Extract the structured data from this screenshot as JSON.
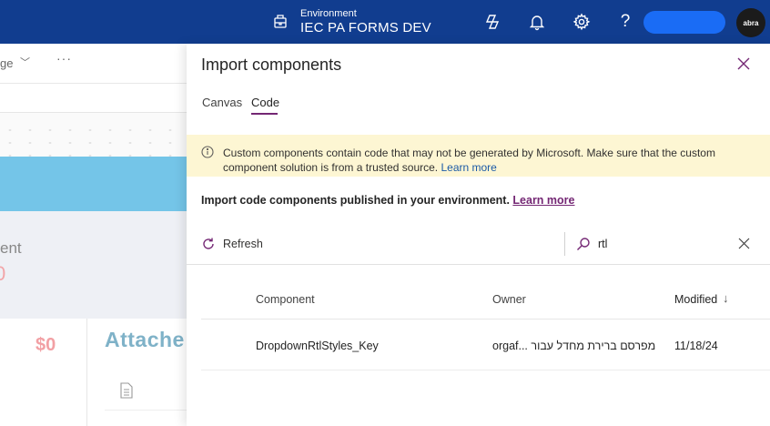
{
  "topbar": {
    "env_label": "Environment",
    "env_name": "IEC PA FORMS DEV",
    "icons": [
      "copilot-icon",
      "bell-icon",
      "gear-icon",
      "help-icon"
    ],
    "help_glyph": "?",
    "avatar_text": "abra",
    "colors": {
      "background": "#113d8f",
      "user_pill": "#1a6cf5"
    }
  },
  "background_app": {
    "page_label": "ge",
    "more": "···",
    "partial_label": "ent",
    "value_1": "0",
    "value_2": "$0",
    "section_title": "Attache"
  },
  "panel": {
    "title": "Import components",
    "tabs": [
      {
        "label": "Canvas",
        "selected": false
      },
      {
        "label": "Code",
        "selected": true
      }
    ],
    "warning": {
      "text": "Custom components contain code that may not be generated by Microsoft. Make sure that the custom component solution is from a trusted source.",
      "link": "Learn more"
    },
    "import_info": {
      "text": "Import code components published in your environment.",
      "link": "Learn more"
    },
    "refresh_label": "Refresh",
    "search": {
      "value": "rtl"
    },
    "table": {
      "headers": {
        "component": "Component",
        "owner": "Owner",
        "modified": "Modified"
      },
      "sort_arrow": "↓",
      "rows": [
        {
          "component": "DropdownRtlStyles_Key",
          "owner": "orgaf... מפרסם ברירת מחדל עבור",
          "modified": "11/18/24"
        }
      ]
    },
    "colors": {
      "accent": "#742774",
      "warning_bg": "#fdf6d3",
      "link": "#1b5aa6"
    }
  }
}
